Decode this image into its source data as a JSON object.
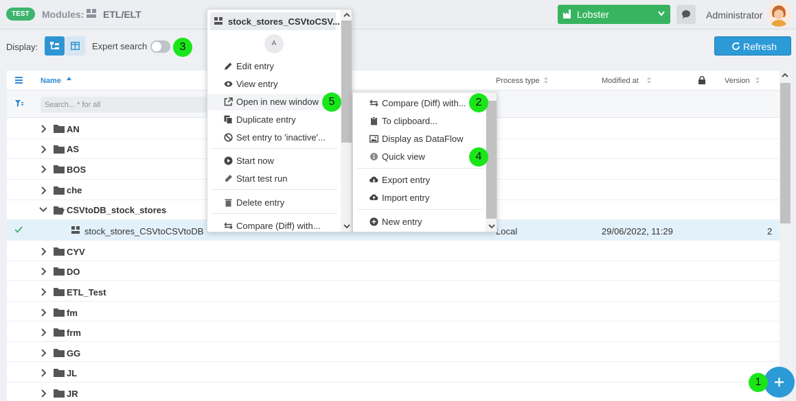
{
  "header": {
    "env_badge": "TEST",
    "modules_label": "Modules:",
    "modules_value": "ETL/ELT",
    "org_selector": "Lobster",
    "user_name": "Administrator"
  },
  "toolbar": {
    "display_label": "Display:",
    "expert_search_label": "Expert search",
    "expert_search_on": false,
    "refresh_label": "Refresh"
  },
  "table": {
    "columns": {
      "name": "Name",
      "process_type": "Process type",
      "modified_at": "Modified at",
      "version": "Version"
    },
    "search_placeholder": "Search... * for all",
    "rows": [
      {
        "type": "folder",
        "label": "AN",
        "expanded": false
      },
      {
        "type": "folder",
        "label": "AS",
        "expanded": false
      },
      {
        "type": "folder",
        "label": "BOS",
        "expanded": false
      },
      {
        "type": "folder",
        "label": "che",
        "expanded": false
      },
      {
        "type": "folder",
        "label": "CSVtoDB_stock_stores",
        "expanded": true
      },
      {
        "type": "entry",
        "label": "stock_stores_CSVtoCSVtoDB",
        "process_type": "Local",
        "modified_at": "29/06/2022, 11:29",
        "version": "2",
        "selected": true
      },
      {
        "type": "folder",
        "label": "CYV",
        "expanded": false
      },
      {
        "type": "folder",
        "label": "DO",
        "expanded": false
      },
      {
        "type": "folder",
        "label": "ETL_Test",
        "expanded": false
      },
      {
        "type": "folder",
        "label": "fm",
        "expanded": false
      },
      {
        "type": "folder",
        "label": "frm",
        "expanded": false
      },
      {
        "type": "folder",
        "label": "GG",
        "expanded": false
      },
      {
        "type": "folder",
        "label": "JL",
        "expanded": false
      },
      {
        "type": "folder",
        "label": "JR",
        "expanded": false
      }
    ]
  },
  "context_menu": {
    "title": "stock_stores_CSVtoCSV...",
    "avatar_initial": "A",
    "items": {
      "edit": "Edit entry",
      "view": "View entry",
      "open_new_window": "Open in new window",
      "duplicate": "Duplicate entry",
      "set_inactive": "Set entry to 'inactive'...",
      "start_now": "Start now",
      "start_test_run": "Start test run",
      "delete": "Delete entry",
      "compare": "Compare (Diff) with..."
    }
  },
  "submenu": {
    "items": {
      "compare": "Compare (Diff) with...",
      "clipboard": "To clipboard...",
      "dataflow": "Display as DataFlow",
      "quick_view": "Quick view",
      "export": "Export entry",
      "import": "Import entry",
      "new_entry": "New entry"
    }
  },
  "markers": [
    "1",
    "2",
    "3",
    "4",
    "5"
  ],
  "colors": {
    "accent_blue": "#2c9ad6",
    "org_green": "#38b460",
    "marker_green": "#19e619"
  }
}
